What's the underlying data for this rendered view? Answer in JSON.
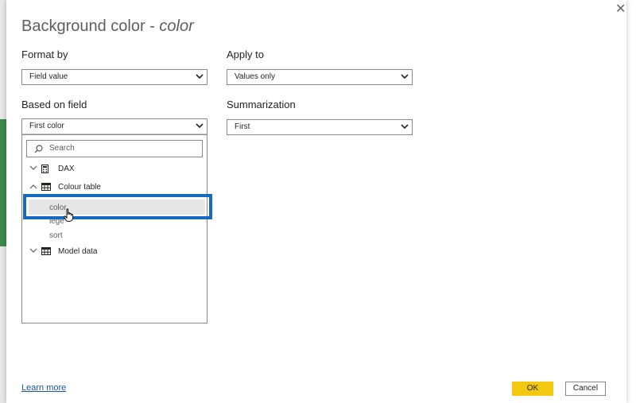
{
  "dialog": {
    "title_main": "Background color - ",
    "title_field": "color"
  },
  "format_by": {
    "label": "Format by",
    "value": "Field value"
  },
  "apply_to": {
    "label": "Apply to",
    "value": "Values only"
  },
  "based_on_field": {
    "label": "Based on field",
    "value": "First color",
    "search_placeholder": "Search",
    "tree": [
      {
        "label": "DAX",
        "expanded": false,
        "icon": "calculator-icon"
      },
      {
        "label": "Colour table",
        "expanded": true,
        "icon": "table-icon",
        "children": [
          "color",
          "lege",
          "sort"
        ]
      },
      {
        "label": "Model data",
        "expanded": false,
        "icon": "table-icon"
      }
    ]
  },
  "summarization": {
    "label": "Summarization",
    "value": "First"
  },
  "footer": {
    "learn_more": "Learn more",
    "ok": "OK",
    "cancel": "Cancel"
  },
  "colors": {
    "accent": "#f2c811",
    "highlight": "#1769c2",
    "link": "#1a55b0"
  }
}
